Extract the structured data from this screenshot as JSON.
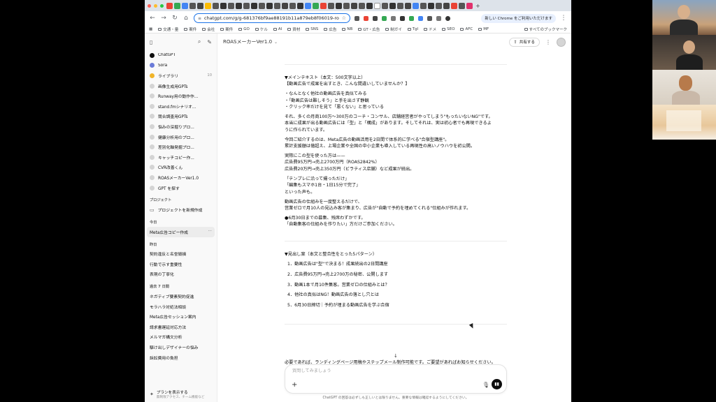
{
  "browser": {
    "url": "chatgpt.com/g/g-681376bf9ae88191b11a879eb8f06019-roasmekav...",
    "chrome_badge": "新しい Chrome をご利用いただけます",
    "bookmarks": [
      "交通・量",
      "案件",
      "会社",
      "案件",
      "GO",
      "ケル",
      "AI",
      "資材",
      "SNS",
      "広告",
      "NB",
      "GT・広告",
      "制ガイ",
      "Tgl",
      "ドメ",
      "SEO",
      "AFC",
      "MF",
      "すべてのブックマーク"
    ],
    "colors": {
      "tabstrip": "#dde3ea",
      "focus": "#1a73e8"
    }
  },
  "sidebar": {
    "top_items": [
      {
        "label": "ChatGPT",
        "icon": "chatgpt-icon",
        "count": ""
      },
      {
        "label": "Sora",
        "icon": "sora-icon",
        "count": ""
      },
      {
        "label": "ライブラリ",
        "icon": "library-icon",
        "count": "10"
      },
      {
        "label": "画像生成用GPTs",
        "icon": "gpt-icon",
        "count": ""
      },
      {
        "label": "Runway用の動作作...",
        "icon": "gpt-icon",
        "count": ""
      },
      {
        "label": "stand.fmシナリオ...",
        "icon": "gpt-icon",
        "count": ""
      },
      {
        "label": "競合調査用GPTs",
        "icon": "gpt-icon",
        "count": ""
      },
      {
        "label": "悩みの深掘りプロ...",
        "icon": "gpt-icon",
        "count": ""
      },
      {
        "label": "健康分析用のプロ...",
        "icon": "gpt-icon",
        "count": ""
      },
      {
        "label": "差別化軸発掘プロ...",
        "icon": "gpt-icon",
        "count": ""
      },
      {
        "label": "キャッチコピー作...",
        "icon": "gpt-icon",
        "count": ""
      },
      {
        "label": "CVR改善くん",
        "icon": "gpt-icon",
        "count": ""
      },
      {
        "label": "ROASメーカーVer1.0",
        "icon": "gpt-icon",
        "count": ""
      },
      {
        "label": "GPT を探す",
        "icon": "explore-icon",
        "count": ""
      }
    ],
    "project_heading": "プロジェクト",
    "new_project": "プロジェクトを新規作成",
    "today_heading": "今日",
    "today_items": [
      "Meta広告コピー作成"
    ],
    "yesterday_heading": "昨日",
    "yesterday_items": [
      "契約違反と名誉毀損",
      "行動で示す重要性",
      "表現の丁寧化"
    ],
    "week_heading": "過去 7 日間",
    "week_items": [
      "ネガティブ要素契約促進",
      "モラハラ対処法相談",
      "Meta広告セッション案内",
      "請求書遅延対応方法",
      "メルマガ構文分析",
      "駆け出しデザイナーの悩み",
      "訴訟費用の負担"
    ],
    "plan_title": "プランを表示する",
    "plan_sub": "無制限アクセス、チーム機能など"
  },
  "header": {
    "model": "ROASメーカーVer1.0",
    "share": "共有する"
  },
  "message": {
    "main_lines": [
      "▼メインテキスト（本文：500文字以上）",
      "【動画広告で成果を出すとき、こんな間違いしていませんか？】",
      "",
      "・なんとなく他社の動画広告を真似てみる",
      "・「動画広告は難しそう」と手を出さず静観",
      "・クリック率だけを見て「悪くない」と思っている",
      "",
      "それ、多くの月商100万〜300万のコーチ・コンサル、店舗経営者がやってしまう\"もったいないNG\"です。",
      "本当に成果が出る動画広告には「型」と「構成」があります。そしてそれは、実は初心者でも再現できるよ",
      "うに作られています。",
      "",
      "今回ご紹介するのは、Meta広告の動画活用を2日間で体系的に学べる\"合宿型講座\"。",
      "累計支援額は億超え、上場企業や全国の中小企業も導入している再現性の高いノウハウを初公開。",
      "",
      "実際にこの型を使った方は——",
      "広告費95万円→売上2700万円（ROAS2842%）",
      "広告費20万円→売上350万円（ビラティス店舗）など成果が続出。",
      "",
      "「テンプレに沿って撮っただけ」",
      "「編集もスマホ1台・1日15分で完了」",
      "といった声も。",
      "",
      "動画広告の仕組みを一度整えるだけで、",
      "営業ゼロで月10人の見込み客が集まり、広告が\"自動で予約を埋めてくれる\"仕組みが作れます。",
      "",
      "●6月30日までの募集、残席わずかです。",
      "「自動集客の仕組みを作りたい」方だけご参加ください。"
    ],
    "headline_title": "▼見出し案（本文と整合性をとった5パターン）",
    "headlines": [
      "1．動画広告は\"型\"で決まる！成果続出の2日間講座",
      "2．広告費95万円→売上2700万の秘密、公開します",
      "3．動画1本で月10件集客。営業ゼロの仕組みとは？",
      "4．他社の真似はNG！動画広告の落とし穴とは",
      "5．6月30日締切｜予約が埋まる動画広告を学ぶ合宿"
    ],
    "tail": "必要であれば、ランディングページ用稿やステップメール制作可能です。ご要望があればお知らせください。"
  },
  "composer": {
    "placeholder": "質問してみましょう"
  },
  "footer": {
    "disclaimer": "ChatGPT の回答は必ずしも正しいとは限りません。重要な情報は確認するようにしてください。"
  }
}
